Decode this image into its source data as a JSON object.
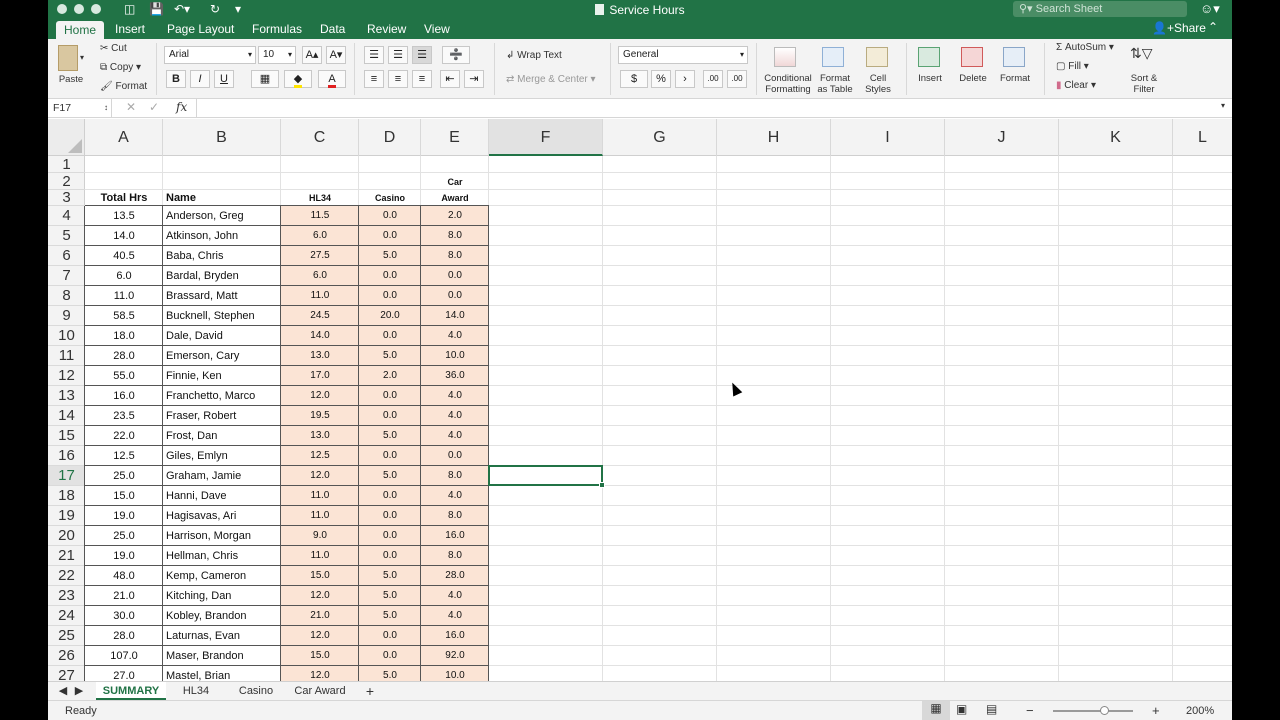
{
  "window": {
    "title": "Service Hours",
    "search_placeholder": "Search Sheet"
  },
  "ribbon_tabs": [
    "Home",
    "Insert",
    "Page Layout",
    "Formulas",
    "Data",
    "Review",
    "View"
  ],
  "share_label": "Share",
  "clipboard": {
    "paste": "Paste",
    "cut": "Cut",
    "copy": "Copy",
    "format": "Format"
  },
  "font": {
    "name": "Arial",
    "size": "10",
    "bold": "B",
    "italic": "I",
    "underline": "U"
  },
  "alignment": {
    "wrap_text": "Wrap Text",
    "merge_center": "Merge & Center"
  },
  "number": {
    "format": "General",
    "currency": "$",
    "percent": "%",
    "comma": "›",
    "inc_decimal": ".00",
    "dec_decimal": ".00"
  },
  "styles": {
    "conditional": [
      "Conditional",
      "Formatting"
    ],
    "format_table": [
      "Format",
      "as Table"
    ],
    "cell_styles": [
      "Cell",
      "Styles"
    ]
  },
  "cells_group": {
    "insert": "Insert",
    "delete": "Delete",
    "format": "Format"
  },
  "editing": {
    "autosum": "AutoSum",
    "fill": "Fill",
    "clear": "Clear",
    "sort_filter": [
      "Sort &",
      "Filter"
    ]
  },
  "formula_bar": {
    "name_box": "F17",
    "fx": "fx"
  },
  "columns": [
    "A",
    "B",
    "C",
    "D",
    "E",
    "F",
    "G",
    "H",
    "I",
    "J",
    "K",
    "L"
  ],
  "row_numbers": [
    "1",
    "2",
    "3",
    "4",
    "5",
    "6",
    "7",
    "8",
    "9",
    "10",
    "11",
    "12",
    "13",
    "14",
    "15",
    "16",
    "17",
    "18",
    "19",
    "20",
    "21",
    "22",
    "23",
    "24",
    "25",
    "26",
    "27"
  ],
  "headers": {
    "total_hrs": "Total Hrs",
    "name": "Name",
    "hl34": "HL34",
    "casino": "Casino",
    "car_line1": "Car",
    "car_line2": "Award"
  },
  "rows": [
    {
      "total": "13.5",
      "name": "Anderson, Greg",
      "hl34": "11.5",
      "casino": "0.0",
      "car": "2.0"
    },
    {
      "total": "14.0",
      "name": "Atkinson, John",
      "hl34": "6.0",
      "casino": "0.0",
      "car": "8.0"
    },
    {
      "total": "40.5",
      "name": "Baba, Chris",
      "hl34": "27.5",
      "casino": "5.0",
      "car": "8.0"
    },
    {
      "total": "6.0",
      "name": "Bardal, Bryden",
      "hl34": "6.0",
      "casino": "0.0",
      "car": "0.0"
    },
    {
      "total": "11.0",
      "name": "Brassard, Matt",
      "hl34": "11.0",
      "casino": "0.0",
      "car": "0.0"
    },
    {
      "total": "58.5",
      "name": "Bucknell, Stephen",
      "hl34": "24.5",
      "casino": "20.0",
      "car": "14.0"
    },
    {
      "total": "18.0",
      "name": "Dale, David",
      "hl34": "14.0",
      "casino": "0.0",
      "car": "4.0"
    },
    {
      "total": "28.0",
      "name": "Emerson, Cary",
      "hl34": "13.0",
      "casino": "5.0",
      "car": "10.0"
    },
    {
      "total": "55.0",
      "name": "Finnie, Ken",
      "hl34": "17.0",
      "casino": "2.0",
      "car": "36.0"
    },
    {
      "total": "16.0",
      "name": "Franchetto, Marco",
      "hl34": "12.0",
      "casino": "0.0",
      "car": "4.0"
    },
    {
      "total": "23.5",
      "name": "Fraser, Robert",
      "hl34": "19.5",
      "casino": "0.0",
      "car": "4.0"
    },
    {
      "total": "22.0",
      "name": "Frost, Dan",
      "hl34": "13.0",
      "casino": "5.0",
      "car": "4.0"
    },
    {
      "total": "12.5",
      "name": "Giles, Emlyn",
      "hl34": "12.5",
      "casino": "0.0",
      "car": "0.0"
    },
    {
      "total": "25.0",
      "name": "Graham, Jamie",
      "hl34": "12.0",
      "casino": "5.0",
      "car": "8.0"
    },
    {
      "total": "15.0",
      "name": "Hanni, Dave",
      "hl34": "11.0",
      "casino": "0.0",
      "car": "4.0"
    },
    {
      "total": "19.0",
      "name": "Hagisavas, Ari",
      "hl34": "11.0",
      "casino": "0.0",
      "car": "8.0"
    },
    {
      "total": "25.0",
      "name": "Harrison, Morgan",
      "hl34": "9.0",
      "casino": "0.0",
      "car": "16.0"
    },
    {
      "total": "19.0",
      "name": "Hellman, Chris",
      "hl34": "11.0",
      "casino": "0.0",
      "car": "8.0"
    },
    {
      "total": "48.0",
      "name": "Kemp, Cameron",
      "hl34": "15.0",
      "casino": "5.0",
      "car": "28.0"
    },
    {
      "total": "21.0",
      "name": "Kitching, Dan",
      "hl34": "12.0",
      "casino": "5.0",
      "car": "4.0"
    },
    {
      "total": "30.0",
      "name": "Kobley, Brandon",
      "hl34": "21.0",
      "casino": "5.0",
      "car": "4.0"
    },
    {
      "total": "28.0",
      "name": "Laturnas, Evan",
      "hl34": "12.0",
      "casino": "0.0",
      "car": "16.0"
    },
    {
      "total": "107.0",
      "name": "Maser, Brandon",
      "hl34": "15.0",
      "casino": "0.0",
      "car": "92.0"
    },
    {
      "total": "27.0",
      "name": "Mastel, Brian",
      "hl34": "12.0",
      "casino": "5.0",
      "car": "10.0"
    }
  ],
  "selected_cell": "F17",
  "sheet_tabs": [
    "SUMMARY",
    "HL34",
    "Casino",
    "Car Award"
  ],
  "add_sheet": "+",
  "status": {
    "text": "Ready",
    "zoom": "200%",
    "zoom_minus": "−",
    "zoom_plus": "+"
  }
}
